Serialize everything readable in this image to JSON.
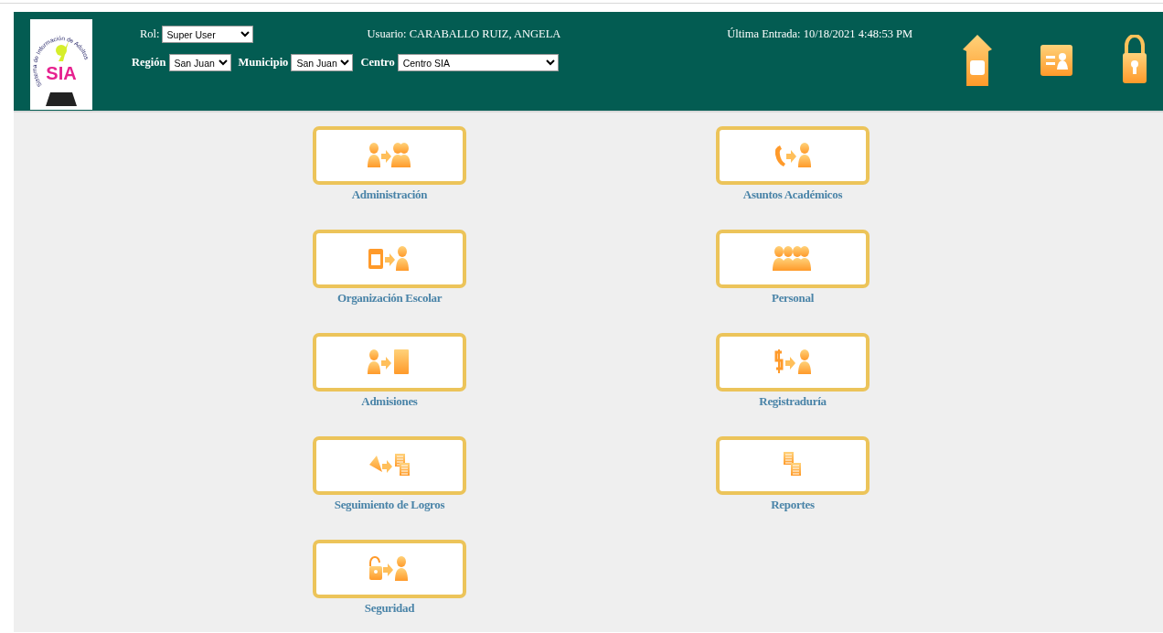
{
  "header": {
    "logo": {
      "arc_text": "Sistema de Información de Adultos",
      "text": "SIA"
    },
    "role": {
      "label": "Rol:",
      "value": "Super User"
    },
    "user": "Usuario: CARABALLO RUIZ, ANGELA",
    "last_login": "Última Entrada: 10/18/2021 4:48:53 PM",
    "filters": [
      {
        "label": "Región",
        "value": "San Juan"
      },
      {
        "label": "Municipio",
        "value": "San Juan"
      },
      {
        "label": "Centro",
        "value": "Centro SIA"
      }
    ]
  },
  "modules": [
    {
      "label": "Administración"
    },
    {
      "label": "Asuntos Académicos"
    },
    {
      "label": "Organización Escolar"
    },
    {
      "label": "Personal"
    },
    {
      "label": "Admisiones"
    },
    {
      "label": "Registraduría"
    },
    {
      "label": "Seguimiento de Logros"
    },
    {
      "label": "Reportes"
    },
    {
      "label": "Seguridad"
    }
  ]
}
